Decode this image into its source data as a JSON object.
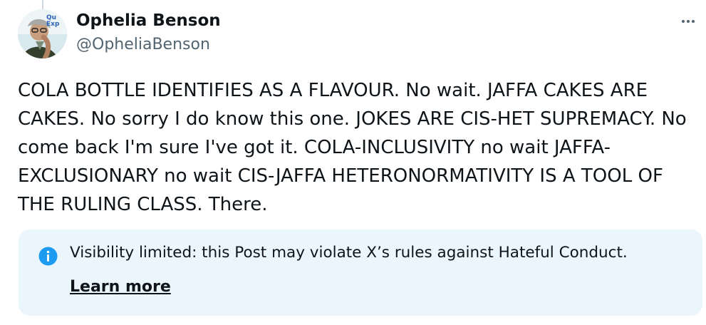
{
  "author": {
    "name": "Ophelia Benson",
    "handle": "@OpheliaBenson",
    "avatar_badge_text": "Qu Exp"
  },
  "post": {
    "text": "COLA BOTTLE IDENTIFIES AS A FLAVOUR. No wait. JAFFA CAKES ARE CAKES. No sorry I do know this one. JOKES ARE CIS-HET SUPREMACY. No come back I'm sure I've got it. COLA-INCLUSIVITY no wait JAFFA-EXCLUSIONARY no wait CIS-JAFFA HETERONORMATIVITY IS A TOOL OF THE RULING CLASS. There."
  },
  "notice": {
    "message": "Visibility limited: this Post may violate X’s rules against Hateful Conduct.",
    "learn_more_label": "Learn more",
    "icon": "info-icon"
  },
  "menu": {
    "icon": "more-options-icon"
  },
  "colors": {
    "text_primary": "#0f1419",
    "text_secondary": "#536471",
    "notice_background": "#eaf6fc",
    "info_blue": "#1d9bf0"
  }
}
